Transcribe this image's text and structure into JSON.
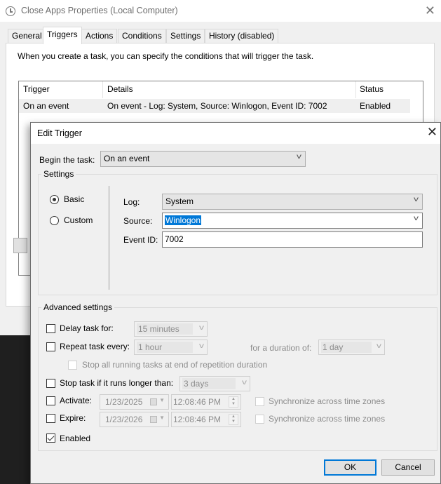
{
  "props_window": {
    "title": "Close Apps Properties (Local Computer)",
    "tabs": [
      "General",
      "Triggers",
      "Actions",
      "Conditions",
      "Settings",
      "History (disabled)"
    ],
    "active_tab": "Triggers",
    "description": "When you create a task, you can specify the conditions that will trigger the task.",
    "table": {
      "headers": [
        "Trigger",
        "Details",
        "Status"
      ],
      "rows": [
        {
          "trigger": "On an event",
          "details": "On event - Log: System, Source: Winlogon, Event ID: 7002",
          "status": "Enabled"
        }
      ]
    }
  },
  "edit_trigger": {
    "title": "Edit Trigger",
    "begin_label": "Begin the task:",
    "begin_value": "On an event",
    "settings_label": "Settings",
    "radio_basic": "Basic",
    "radio_custom": "Custom",
    "selected_mode": "Basic",
    "log_label": "Log:",
    "log_value": "System",
    "source_label": "Source:",
    "source_value": "Winlogon",
    "event_id_label": "Event ID:",
    "event_id_value": "7002",
    "advanced_label": "Advanced settings",
    "delay_label": "Delay task for:",
    "delay_value": "15 minutes",
    "delay_checked": false,
    "repeat_label": "Repeat task every:",
    "repeat_value": "1 hour",
    "repeat_checked": false,
    "duration_label": "for a duration of:",
    "duration_value": "1 day",
    "stop_all_label": "Stop all running tasks at end of repetition duration",
    "stop_all_checked": false,
    "stop_longer_label": "Stop task if it runs longer than:",
    "stop_longer_value": "3 days",
    "stop_longer_checked": false,
    "activate_label": "Activate:",
    "activate_date": "1/23/2025",
    "activate_time": "12:08:46 PM",
    "activate_checked": false,
    "expire_label": "Expire:",
    "expire_date": "1/23/2026",
    "expire_time": "12:08:46 PM",
    "expire_checked": false,
    "sync_label": "Synchronize across time zones",
    "enabled_label": "Enabled",
    "enabled_checked": true,
    "ok_label": "OK",
    "cancel_label": "Cancel"
  }
}
